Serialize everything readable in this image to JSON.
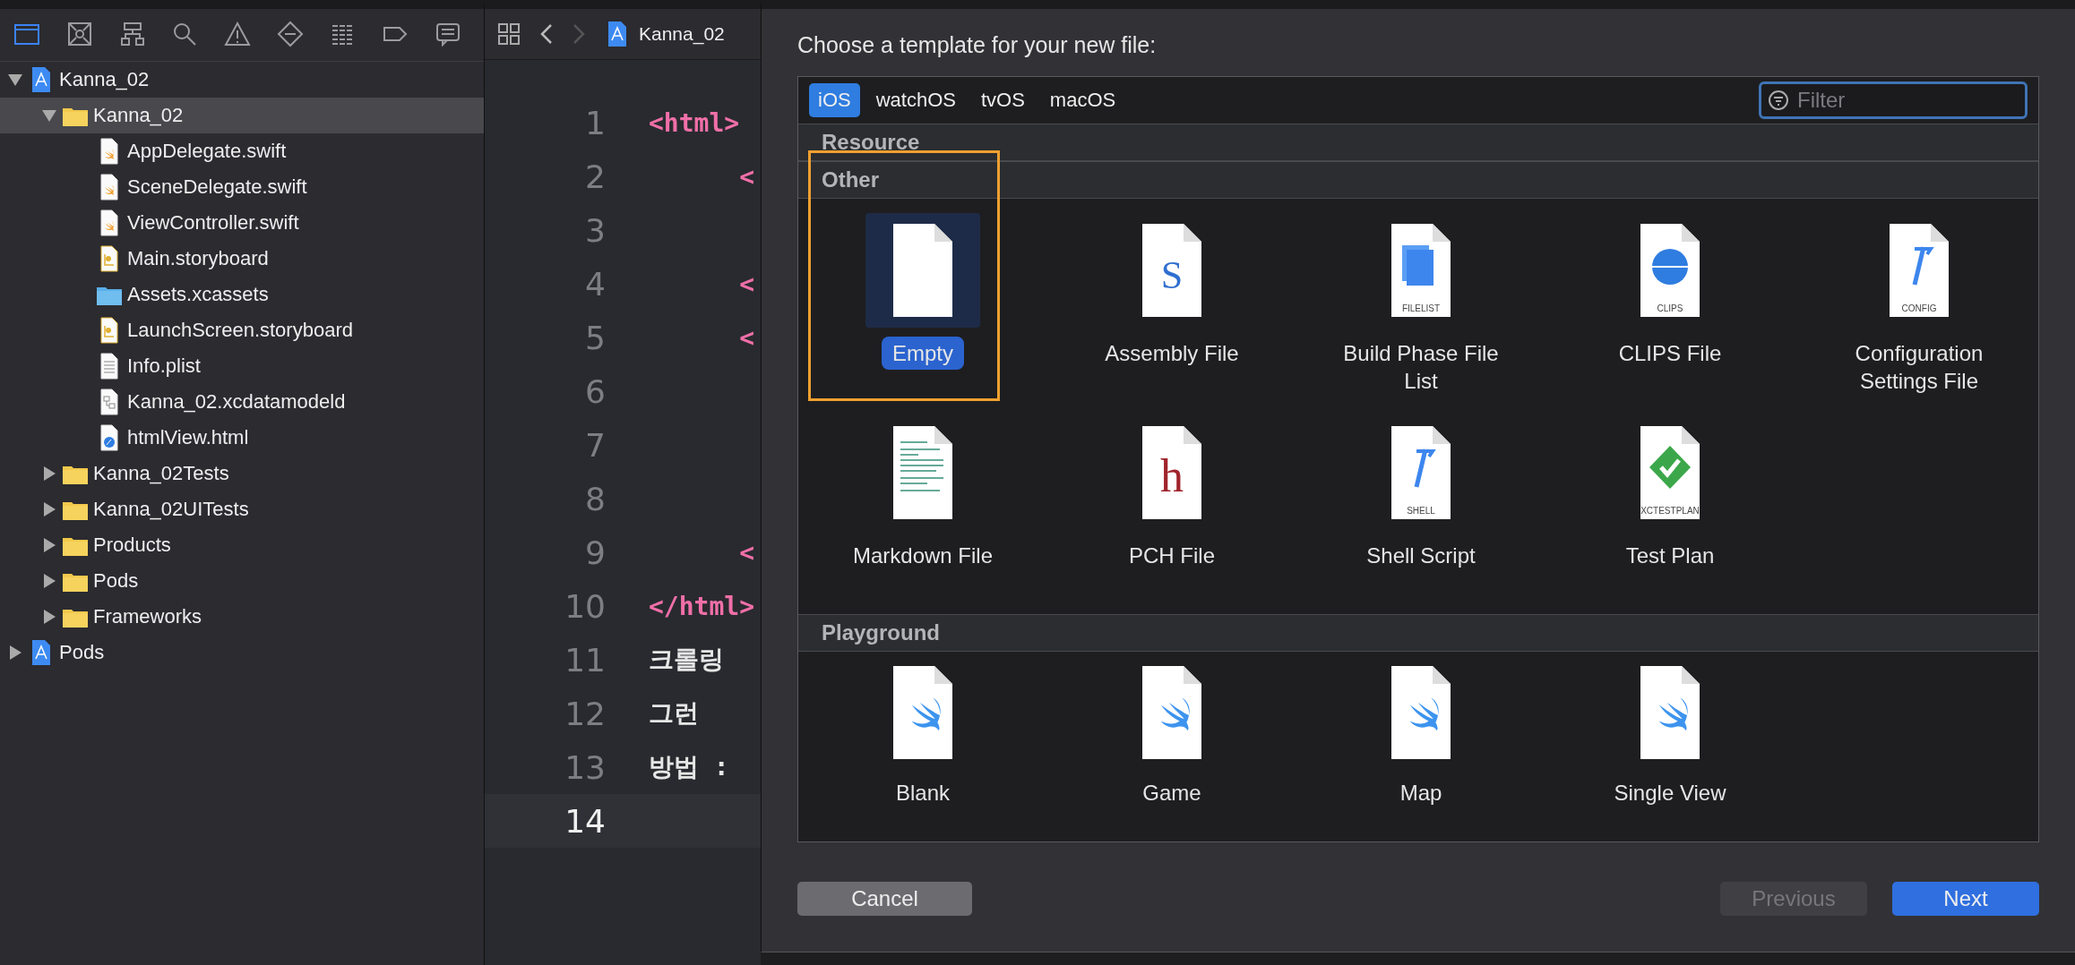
{
  "navigator": {
    "toolbar": [
      {
        "kind": "folder",
        "selected": true
      },
      {
        "kind": "source-control",
        "selected": false
      },
      {
        "kind": "hierarchy",
        "selected": false
      },
      {
        "kind": "search",
        "selected": false
      },
      {
        "kind": "warning",
        "selected": false
      },
      {
        "kind": "test",
        "selected": false
      },
      {
        "kind": "debug",
        "selected": false
      },
      {
        "kind": "breakpoint",
        "selected": false
      },
      {
        "kind": "report",
        "selected": false
      }
    ],
    "tree": [
      {
        "label": "Kanna_02",
        "kind": "project",
        "expanded": true,
        "selected": false,
        "children": [
          {
            "label": "Kanna_02",
            "kind": "folder",
            "expanded": true,
            "selected": true,
            "children": [
              {
                "label": "AppDelegate.swift",
                "kind": "swift",
                "selected": false
              },
              {
                "label": "SceneDelegate.swift",
                "kind": "swift",
                "selected": false
              },
              {
                "label": "ViewController.swift",
                "kind": "swift",
                "selected": false
              },
              {
                "label": "Main.storyboard",
                "kind": "storyboard",
                "selected": false
              },
              {
                "label": "Assets.xcassets",
                "kind": "assets",
                "selected": false
              },
              {
                "label": "LaunchScreen.storyboard",
                "kind": "storyboard",
                "selected": false
              },
              {
                "label": "Info.plist",
                "kind": "plist",
                "selected": false
              },
              {
                "label": "Kanna_02.xcdatamodeld",
                "kind": "datamodel",
                "selected": false
              },
              {
                "label": "htmlView.html",
                "kind": "html",
                "selected": false
              }
            ]
          },
          {
            "label": "Kanna_02Tests",
            "kind": "folder",
            "expanded": false,
            "selected": false
          },
          {
            "label": "Kanna_02UITests",
            "kind": "folder",
            "expanded": false,
            "selected": false
          },
          {
            "label": "Products",
            "kind": "folder",
            "expanded": false,
            "selected": false
          },
          {
            "label": "Pods",
            "kind": "folder",
            "expanded": false,
            "selected": false
          },
          {
            "label": "Frameworks",
            "kind": "folder",
            "expanded": false,
            "selected": false
          }
        ]
      },
      {
        "label": "Pods",
        "kind": "project",
        "expanded": false,
        "selected": false
      }
    ]
  },
  "editor": {
    "tab": {
      "title": "Kanna_02"
    },
    "lines": [
      {
        "number": "1",
        "code": "<html>",
        "kind": "tag",
        "current": false
      },
      {
        "number": "2",
        "code": "      <",
        "kind": "tag",
        "current": false
      },
      {
        "number": "3",
        "current": false
      },
      {
        "number": "4",
        "code": "      <",
        "kind": "tag",
        "current": false
      },
      {
        "number": "5",
        "code": "      <",
        "kind": "tag",
        "current": false
      },
      {
        "number": "6",
        "current": false
      },
      {
        "number": "7",
        "current": false
      },
      {
        "number": "8",
        "current": false
      },
      {
        "number": "9",
        "code": "      <",
        "kind": "tag",
        "current": false
      },
      {
        "number": "10",
        "code": "</html>",
        "kind": "tag",
        "current": false
      },
      {
        "number": "11",
        "code": "크롤링",
        "kind": "text",
        "current": false
      },
      {
        "number": "12",
        "code": "그런",
        "kind": "text",
        "current": false
      },
      {
        "number": "13",
        "code": "방법 :",
        "kind": "text",
        "current": false
      },
      {
        "number": "14",
        "current": true
      }
    ]
  },
  "dialog": {
    "title": "Choose a template for your new file:",
    "platforms": [
      {
        "label": "iOS",
        "selected": true
      },
      {
        "label": "watchOS",
        "selected": false
      },
      {
        "label": "tvOS",
        "selected": false
      },
      {
        "label": "macOS",
        "selected": false
      }
    ],
    "filter": {
      "placeholder": "Filter"
    },
    "sections": [
      {
        "title": "Resource"
      },
      {
        "title": "Other",
        "templates": [
          {
            "name": "Empty",
            "kind": "empty",
            "selected": true,
            "annotated": true
          },
          {
            "name": "Assembly File",
            "kind": "assembly",
            "glyph": "S",
            "selected": false,
            "annotated": false
          },
          {
            "name": "Build Phase File List",
            "kind": "filelist",
            "badge": "FILELIST",
            "selected": false,
            "annotated": false
          },
          {
            "name": "CLIPS File",
            "kind": "clips",
            "badge": "CLIPS",
            "selected": false,
            "annotated": false
          },
          {
            "name": "Configuration Settings File",
            "kind": "config",
            "badge": "CONFIG",
            "selected": false,
            "annotated": false
          },
          {
            "name": "Markdown File",
            "kind": "markdown",
            "selected": false,
            "annotated": false
          },
          {
            "name": "PCH File",
            "kind": "pch",
            "glyph": "h",
            "selected": false,
            "annotated": false
          },
          {
            "name": "Shell Script",
            "kind": "shell",
            "badge": "SHELL",
            "selected": false,
            "annotated": false
          },
          {
            "name": "Test Plan",
            "kind": "testplan",
            "badge": "XCTESTPLAN",
            "selected": false,
            "annotated": false
          }
        ]
      },
      {
        "title": "Playground",
        "templates": [
          {
            "name": "Blank",
            "kind": "swift",
            "selected": false,
            "annotated": false
          },
          {
            "name": "Game",
            "kind": "swift",
            "selected": false,
            "annotated": false
          },
          {
            "name": "Map",
            "kind": "swift",
            "selected": false,
            "annotated": false
          },
          {
            "name": "Single View",
            "kind": "swift",
            "selected": false,
            "annotated": false
          }
        ]
      }
    ],
    "buttons": [
      {
        "label": "Cancel",
        "kind": "default",
        "disabled": false
      },
      {
        "label": "Previous",
        "kind": "primary",
        "disabled": true
      },
      {
        "label": "Next",
        "kind": "primary",
        "disabled": false
      }
    ]
  }
}
